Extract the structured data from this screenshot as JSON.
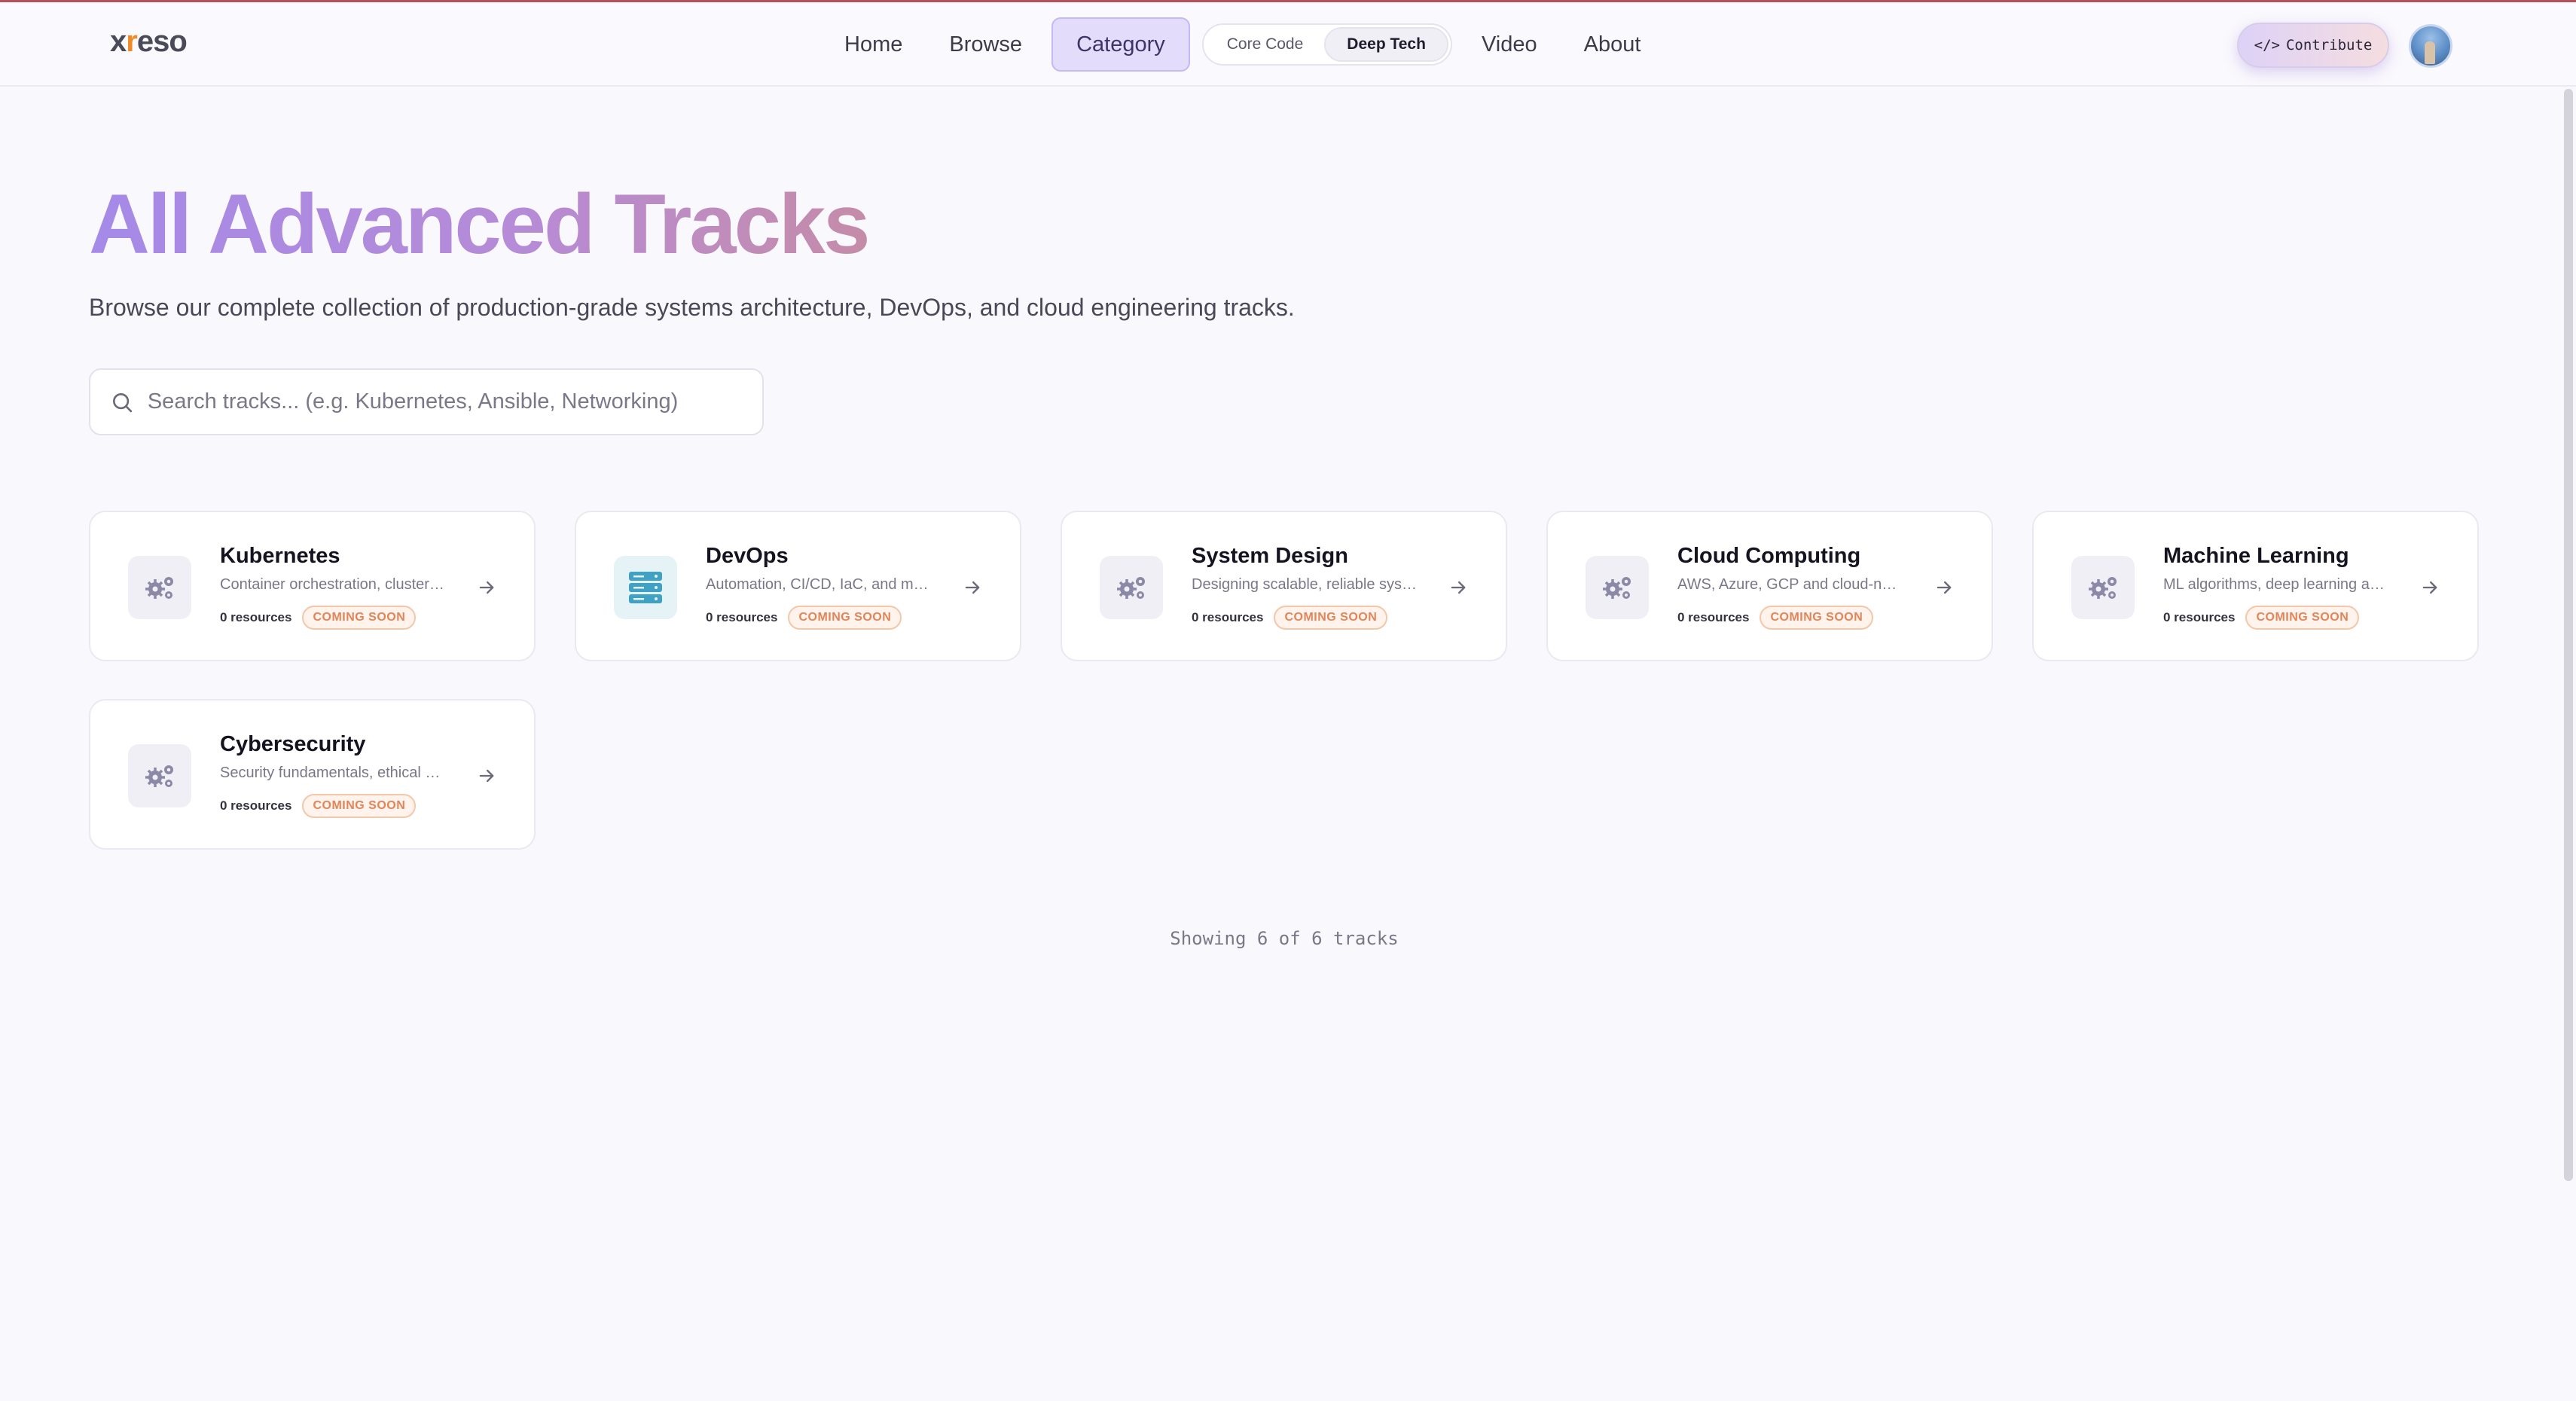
{
  "brand": {
    "logo": "xreso"
  },
  "nav": {
    "links": [
      "Home",
      "Browse",
      "Category",
      "Video",
      "About"
    ],
    "toggle": [
      "Core Code",
      "Deep Tech"
    ],
    "contribute_label": "Contribute",
    "contribute_prefix": "</>"
  },
  "page": {
    "title": "All Advanced Tracks",
    "subtitle": "Browse our complete collection of production-grade systems architecture, DevOps, and cloud engineering tracks.",
    "search_placeholder": "Search tracks... (e.g. Kubernetes, Ansible, Networking)"
  },
  "tracks": [
    {
      "title": "Kubernetes",
      "desc": "Container orchestration, cluster management",
      "resources": "0 resources",
      "badge": "COMING SOON",
      "icon": "gears-icon"
    },
    {
      "title": "DevOps",
      "desc": "Automation, CI/CD, IaC, and monitoring",
      "resources": "0 resources",
      "badge": "COMING SOON",
      "icon": "server-stack-icon"
    },
    {
      "title": "System Design",
      "desc": "Designing scalable, reliable systems",
      "resources": "0 resources",
      "badge": "COMING SOON",
      "icon": "gears-icon"
    },
    {
      "title": "Cloud Computing",
      "desc": "AWS, Azure, GCP and cloud-native",
      "resources": "0 resources",
      "badge": "COMING SOON",
      "icon": "gears-icon"
    },
    {
      "title": "Machine Learning",
      "desc": "ML algorithms, deep learning and AI",
      "resources": "0 resources",
      "badge": "COMING SOON",
      "icon": "gears-icon"
    },
    {
      "title": "Cybersecurity",
      "desc": "Security fundamentals, ethical hacking",
      "resources": "0 resources",
      "badge": "COMING SOON",
      "icon": "gears-icon"
    }
  ],
  "footer": {
    "showing": "Showing 6 of 6 tracks"
  },
  "colors": {
    "accent": "#a58ae8",
    "badge": "#e0855a",
    "teal": "#3fa2c4"
  }
}
